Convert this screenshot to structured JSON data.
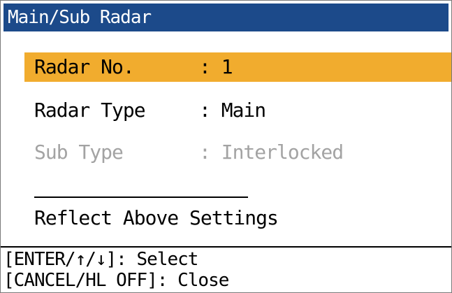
{
  "window": {
    "title": "Main/Sub Radar"
  },
  "menu": {
    "items": [
      {
        "label": "Radar No.",
        "value": ": 1",
        "state": "selected"
      },
      {
        "label": "Radar Type",
        "value": ": Main",
        "state": "normal"
      },
      {
        "label": "Sub Type",
        "value": ": Interlocked",
        "state": "disabled"
      }
    ],
    "action_label": "Reflect Above Settings"
  },
  "help": {
    "lines": [
      "[ENTER/↑/↓]: Select",
      "[CANCEL/HL OFF]: Close"
    ]
  },
  "colors": {
    "titlebar": "#1c4a8a",
    "selection": "#f1ac2e",
    "disabled_text": "#a3a3a3"
  }
}
